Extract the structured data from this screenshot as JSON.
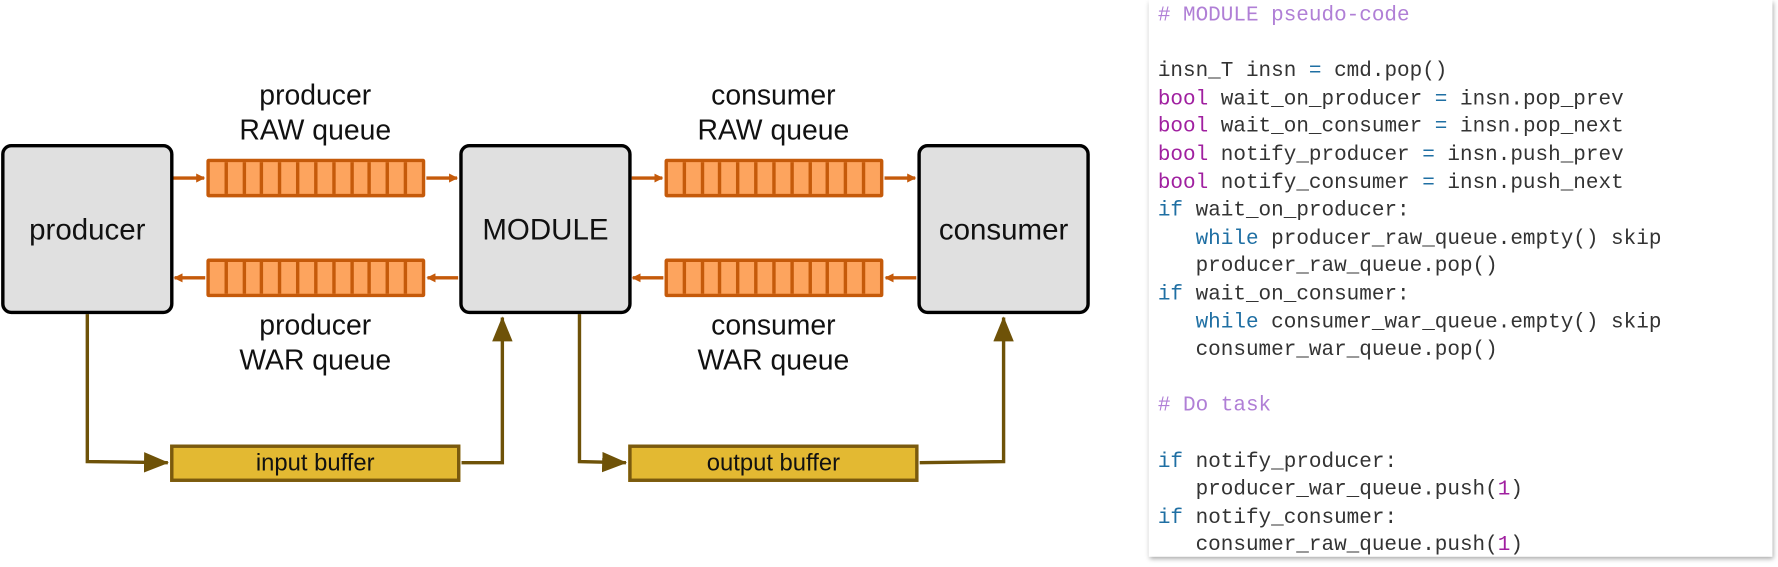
{
  "diagram": {
    "nodes": {
      "producer": "producer",
      "module": "MODULE",
      "consumer": "consumer"
    },
    "queues": {
      "producer_raw": {
        "line1": "producer",
        "line2": "RAW queue",
        "cells": 12
      },
      "producer_war": {
        "line1": "producer",
        "line2": "WAR queue",
        "cells": 12
      },
      "consumer_raw": {
        "line1": "consumer",
        "line2": "RAW queue",
        "cells": 12
      },
      "consumer_war": {
        "line1": "consumer",
        "line2": "WAR queue",
        "cells": 12
      }
    },
    "buffers": {
      "input": "input buffer",
      "output": "output buffer"
    },
    "colors": {
      "node_fill": "#e0e0e0",
      "queue_fill": "#fda45e",
      "queue_stroke": "#c55a0a",
      "buffer_fill": "#e3b932",
      "buffer_stroke": "#7a5a0e"
    }
  },
  "code": {
    "lines": [
      [
        {
          "t": "# MODULE pseudo-code",
          "c": "cmt"
        }
      ],
      [],
      [
        {
          "t": "insn_T insn "
        },
        {
          "t": "=",
          "c": "op"
        },
        {
          "t": " cmd.pop()"
        }
      ],
      [
        {
          "t": "bool",
          "c": "kw1"
        },
        {
          "t": " wait_on_producer "
        },
        {
          "t": "=",
          "c": "op"
        },
        {
          "t": " insn.pop_prev"
        }
      ],
      [
        {
          "t": "bool",
          "c": "kw1"
        },
        {
          "t": " wait_on_consumer "
        },
        {
          "t": "=",
          "c": "op"
        },
        {
          "t": " insn.pop_next"
        }
      ],
      [
        {
          "t": "bool",
          "c": "kw1"
        },
        {
          "t": " notify_producer "
        },
        {
          "t": "=",
          "c": "op"
        },
        {
          "t": " insn.push_prev"
        }
      ],
      [
        {
          "t": "bool",
          "c": "kw1"
        },
        {
          "t": " notify_consumer "
        },
        {
          "t": "=",
          "c": "op"
        },
        {
          "t": " insn.push_next"
        }
      ],
      [
        {
          "t": "if",
          "c": "kw2"
        },
        {
          "t": " wait_on_producer:"
        }
      ],
      [
        {
          "t": "   "
        },
        {
          "t": "while",
          "c": "kw2"
        },
        {
          "t": " producer_raw_queue.empty() skip"
        }
      ],
      [
        {
          "t": "   producer_raw_queue.pop()"
        }
      ],
      [
        {
          "t": "if",
          "c": "kw2"
        },
        {
          "t": " wait_on_consumer:"
        }
      ],
      [
        {
          "t": "   "
        },
        {
          "t": "while",
          "c": "kw2"
        },
        {
          "t": " consumer_war_queue.empty() skip"
        }
      ],
      [
        {
          "t": "   consumer_war_queue.pop()"
        }
      ],
      [],
      [
        {
          "t": "# Do task",
          "c": "cmt"
        }
      ],
      [],
      [
        {
          "t": "if",
          "c": "kw2"
        },
        {
          "t": " notify_producer:"
        }
      ],
      [
        {
          "t": "   producer_war_queue.push("
        },
        {
          "t": "1",
          "c": "num"
        },
        {
          "t": ")"
        }
      ],
      [
        {
          "t": "if",
          "c": "kw2"
        },
        {
          "t": " notify_consumer:"
        }
      ],
      [
        {
          "t": "   consumer_raw_queue.push("
        },
        {
          "t": "1",
          "c": "num"
        },
        {
          "t": ")"
        }
      ]
    ]
  }
}
